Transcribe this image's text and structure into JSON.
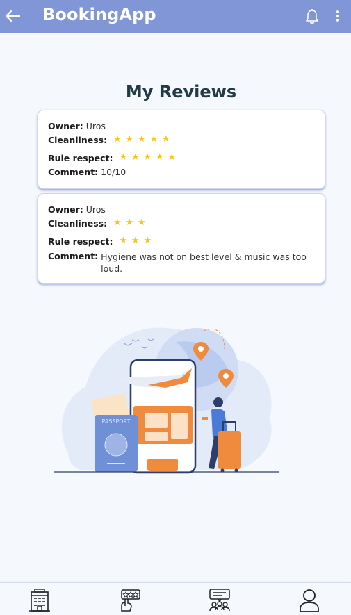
{
  "app": {
    "title": "BookingApp"
  },
  "page": {
    "title": "My Reviews"
  },
  "labels": {
    "owner": "Owner:",
    "cleanliness": "Cleanliness:",
    "rule_respect": "Rule respect:",
    "comment": "Comment:"
  },
  "reviews": [
    {
      "owner": "Uros",
      "cleanliness": 5,
      "rule_respect": 5,
      "comment": "10/10"
    },
    {
      "owner": "Uros",
      "cleanliness": 3,
      "rule_respect": 3,
      "comment": "Hygiene was not on best level & music was too loud."
    }
  ],
  "illustration": {
    "passport_label": "PASSPORT"
  },
  "bottom_nav": [
    {
      "icon": "hotel-icon"
    },
    {
      "icon": "rating-icon"
    },
    {
      "icon": "forum-icon"
    },
    {
      "icon": "profile-icon"
    }
  ],
  "colors": {
    "appbar": "#8196d6",
    "star": "#f5c518",
    "title": "#233b45",
    "accent_orange": "#f08a3c"
  }
}
